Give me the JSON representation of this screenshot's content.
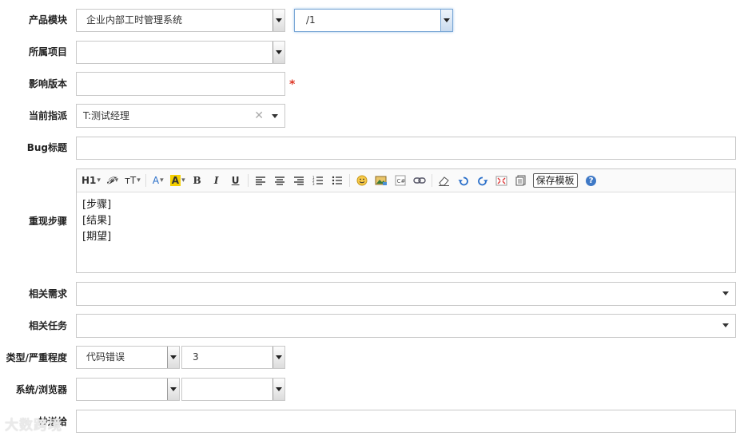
{
  "form": {
    "product_module": {
      "label": "产品模块",
      "value": "企业内部工时管理系统",
      "sub_value": "/1"
    },
    "project": {
      "label": "所属项目",
      "value": ""
    },
    "version": {
      "label": "影响版本",
      "value": "",
      "required_mark": "*"
    },
    "assign": {
      "label": "当前指派",
      "value": "T:测试经理",
      "clear": "✕"
    },
    "bug_title": {
      "label": "Bug标题",
      "value": ""
    },
    "steps": {
      "label": "重现步骤",
      "lines": [
        "[步骤]",
        "[结果]",
        "[期望]"
      ],
      "toolbar": {
        "heading": "H1",
        "font_family": "𝓕",
        "font_size": "тT",
        "font_color": "A",
        "bg_color": "A",
        "bold": "B",
        "italic": "I",
        "underline": "U",
        "save_template": "保存模板",
        "help": "?"
      }
    },
    "story": {
      "label": "相关需求",
      "value": ""
    },
    "task": {
      "label": "相关任务",
      "value": ""
    },
    "type_severity": {
      "label": "类型/严重程度",
      "type_value": "代码错误",
      "severity_value": "3"
    },
    "os_browser": {
      "label": "系统/浏览器",
      "os_value": "",
      "browser_value": ""
    },
    "cc": {
      "label": "抄送给",
      "value": ""
    }
  },
  "watermark": "大数跨境",
  "colors": {
    "required": "#dd3322",
    "focus_border": "#7aa7d6",
    "highlight": "#f5d000",
    "link_blue": "#2a6fc9"
  }
}
